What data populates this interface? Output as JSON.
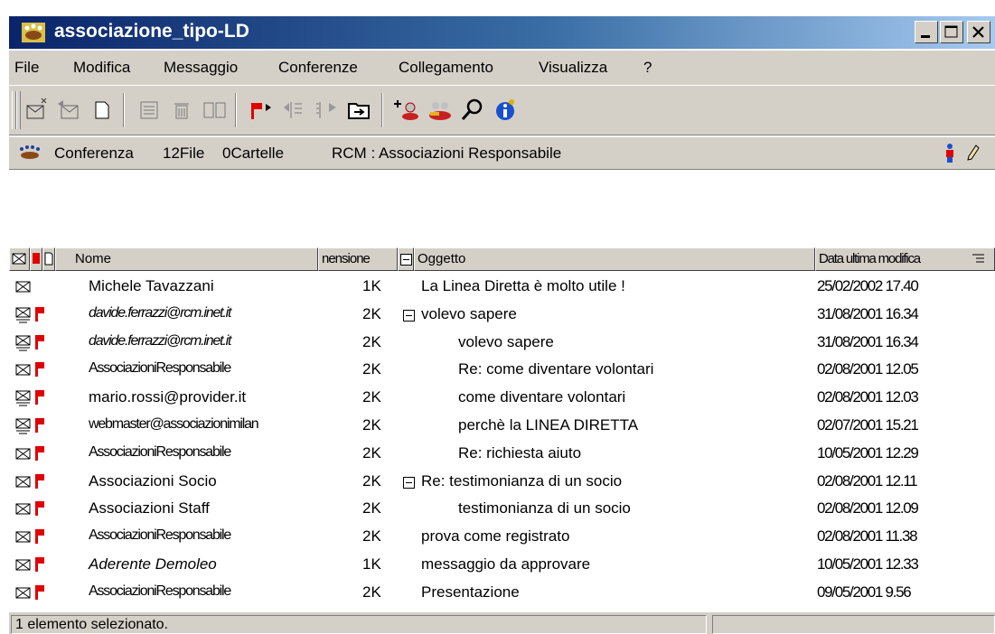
{
  "window": {
    "title": "associazione_tipo-LD"
  },
  "menu": [
    "File",
    "Modifica",
    "Messaggio",
    "Conferenze",
    "Collegamento",
    "Visualizza",
    "?"
  ],
  "conference_bar": {
    "type": "Conferenza",
    "files": "12File",
    "folders": "0Cartelle",
    "path": "RCM : Associazioni Responsabile"
  },
  "columns": {
    "name": "Nome",
    "size": "nensione",
    "subject": "Oggetto",
    "date": "Data ultima modifica"
  },
  "rows": [
    {
      "name": "Michele Tavazzani",
      "size": "1K",
      "subject": "La Linea Diretta è molto utile !",
      "date": "25/02/2002 17.40",
      "flag": false,
      "icon": "envelope-icon",
      "style": "normal",
      "indent": 0,
      "expander": false
    },
    {
      "name": "davide.ferrazzi@rcm.inet.it",
      "size": "2K",
      "subject": "volevo sapere",
      "date": "31/08/2001 16.34",
      "flag": true,
      "icon": "envelope-stack-icon",
      "style": "italic-narrow",
      "indent": 0,
      "expander": true
    },
    {
      "name": "davide.ferrazzi@rcm.inet.it",
      "size": "2K",
      "subject": "volevo sapere",
      "date": "31/08/2001 16.34",
      "flag": true,
      "icon": "envelope-stack-icon",
      "style": "italic-narrow",
      "indent": 1,
      "expander": false
    },
    {
      "name": "AssociazioniResponsabile",
      "size": "2K",
      "subject": "Re: come diventare volontari",
      "date": "02/08/2001 12.05",
      "flag": true,
      "icon": "envelope-icon",
      "style": "narrow",
      "indent": 1,
      "expander": false
    },
    {
      "name": "mario.rossi@provider.it",
      "size": "2K",
      "subject": "come diventare volontari",
      "date": "02/08/2001 12.03",
      "flag": true,
      "icon": "envelope-stack-icon",
      "style": "normal",
      "indent": 1,
      "expander": false
    },
    {
      "name": "webmaster@associazionimilan",
      "size": "2K",
      "subject": "perchè la LINEA DIRETTA",
      "date": "02/07/2001 15.21",
      "flag": true,
      "icon": "envelope-stack-icon",
      "style": "narrow",
      "indent": 1,
      "expander": false
    },
    {
      "name": "AssociazioniResponsabile",
      "size": "2K",
      "subject": "Re: richiesta aiuto",
      "date": "10/05/2001 12.29",
      "flag": true,
      "icon": "envelope-icon",
      "style": "narrow",
      "indent": 1,
      "expander": false
    },
    {
      "name": "Associazioni Socio",
      "size": "2K",
      "subject": "Re: testimonianza di un socio",
      "date": "02/08/2001 12.11",
      "flag": true,
      "icon": "envelope-icon",
      "style": "normal",
      "indent": 0,
      "expander": true
    },
    {
      "name": "Associazioni Staff",
      "size": "2K",
      "subject": "testimonianza di un socio",
      "date": "02/08/2001 12.09",
      "flag": true,
      "icon": "envelope-icon",
      "style": "normal",
      "indent": 1,
      "expander": false
    },
    {
      "name": "AssociazioniResponsabile",
      "size": "2K",
      "subject": "prova come registrato",
      "date": "02/08/2001 11.38",
      "flag": true,
      "icon": "envelope-icon",
      "style": "narrow",
      "indent": 0,
      "expander": false
    },
    {
      "name": "Aderente Demoleo",
      "size": "1K",
      "subject": "messaggio da approvare",
      "date": "10/05/2001 12.33",
      "flag": true,
      "icon": "envelope-icon",
      "style": "italic",
      "indent": 0,
      "expander": false
    },
    {
      "name": "AssociazioniResponsabile",
      "size": "2K",
      "subject": "Presentazione",
      "date": "09/05/2001 9.56",
      "flag": true,
      "icon": "envelope-icon",
      "style": "narrow",
      "indent": 0,
      "expander": false
    }
  ],
  "status": {
    "text": "1 elemento selezionato."
  },
  "colors": {
    "title_start": "#0a246a",
    "title_end": "#a6caf0",
    "flag": "#e00000",
    "chrome": "#d4d0c8"
  }
}
